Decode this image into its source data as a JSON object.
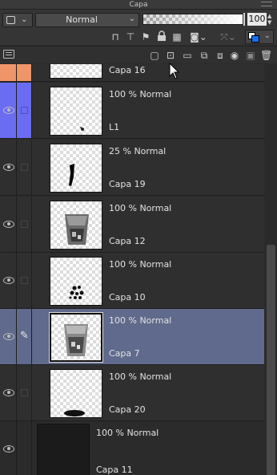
{
  "panel": {
    "title": "Capa"
  },
  "toolbar": {
    "blend_mode": "Normal",
    "opacity_value": "100",
    "opacity_fraction": 1.0,
    "colors": {
      "main": "#ffffff",
      "sub": "#1a6ff0"
    }
  },
  "layers": [
    {
      "name": "Capa 16",
      "props": "",
      "visible": true,
      "color_label": "#f0956a",
      "partially_visible": true
    },
    {
      "name": "L1",
      "props": "100 % Normal",
      "visible": true,
      "color_label": "#6a6cf2"
    },
    {
      "name": "Capa 19",
      "props": "25 % Normal",
      "visible": true
    },
    {
      "name": "Capa 12",
      "props": "100 % Normal",
      "visible": true
    },
    {
      "name": "Capa 10",
      "props": "100 % Normal",
      "visible": true
    },
    {
      "name": "Capa 7",
      "props": "100 % Normal",
      "visible": true,
      "selected": true,
      "editing_icon": "pencil-icon"
    },
    {
      "name": "Capa 20",
      "props": "100 % Normal",
      "visible": true
    },
    {
      "name": "Capa 11",
      "props": "100 % Normal",
      "visible": true,
      "folder_like": true
    }
  ]
}
